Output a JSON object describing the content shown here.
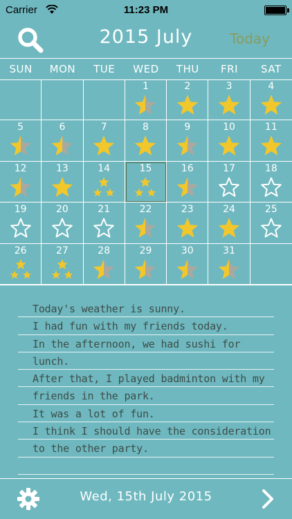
{
  "status_bar": {
    "carrier": "Carrier",
    "time": "11:23 PM"
  },
  "header": {
    "title": "2015 July",
    "today_label": "Today"
  },
  "weekdays": [
    "SUN",
    "MON",
    "TUE",
    "WED",
    "THU",
    "FRI",
    "SAT"
  ],
  "calendar": {
    "leading_blanks": 3,
    "selected_day": 15,
    "days": [
      {
        "day": "1",
        "mark": "half-star"
      },
      {
        "day": "2",
        "mark": "star"
      },
      {
        "day": "3",
        "mark": "star"
      },
      {
        "day": "4",
        "mark": "star"
      },
      {
        "day": "5",
        "mark": "half-star"
      },
      {
        "day": "6",
        "mark": "half-star"
      },
      {
        "day": "7",
        "mark": "star"
      },
      {
        "day": "8",
        "mark": "star"
      },
      {
        "day": "9",
        "mark": "half-star"
      },
      {
        "day": "10",
        "mark": "star"
      },
      {
        "day": "11",
        "mark": "star"
      },
      {
        "day": "12",
        "mark": "half-star"
      },
      {
        "day": "13",
        "mark": "star"
      },
      {
        "day": "14",
        "mark": "triple-star"
      },
      {
        "day": "15",
        "mark": "triple-star"
      },
      {
        "day": "16",
        "mark": "half-star"
      },
      {
        "day": "17",
        "mark": "empty-star"
      },
      {
        "day": "18",
        "mark": "empty-star"
      },
      {
        "day": "19",
        "mark": "empty-star"
      },
      {
        "day": "20",
        "mark": "empty-star"
      },
      {
        "day": "21",
        "mark": "empty-star"
      },
      {
        "day": "22",
        "mark": "half-star"
      },
      {
        "day": "23",
        "mark": "star"
      },
      {
        "day": "24",
        "mark": "star"
      },
      {
        "day": "25",
        "mark": "empty-star"
      },
      {
        "day": "26",
        "mark": "triple-star"
      },
      {
        "day": "27",
        "mark": "triple-star"
      },
      {
        "day": "28",
        "mark": "half-star"
      },
      {
        "day": "29",
        "mark": "half-star"
      },
      {
        "day": "30",
        "mark": "half-star"
      },
      {
        "day": "31",
        "mark": "half-star"
      }
    ],
    "trailing_blanks": 1
  },
  "diary": {
    "lines": [
      "Today's weather is sunny.",
      "I had fun with my friends today.",
      "In the afternoon, we had sushi for",
      "lunch.",
      "After that, I played badminton with my",
      "friends in the park.",
      "It was a lot of fun.",
      "I think I should have the consideration",
      "to the other party.",
      ""
    ]
  },
  "footer": {
    "date": "Wed, 15th July 2015"
  },
  "colors": {
    "background": "#6fb8bf",
    "star_yellow": "#f2c72c",
    "star_gray": "#a9a9a0",
    "today_text": "#8a9b5c",
    "diary_text": "#3c4d4a"
  },
  "icons": {
    "search": "search-icon",
    "gear": "gear-icon",
    "next": "chevron-right-icon",
    "wifi": "wifi-icon",
    "battery": "battery-icon"
  }
}
